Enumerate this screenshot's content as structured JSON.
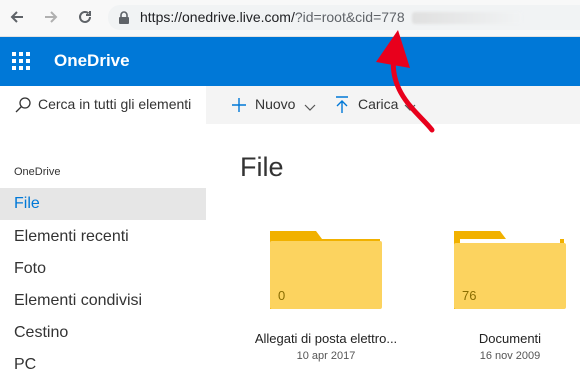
{
  "browser": {
    "url_host": "https://onedrive.live.com/",
    "url_query": "?id=root&cid=778"
  },
  "header": {
    "app_name": "OneDrive",
    "accent": "#0078d7"
  },
  "search": {
    "placeholder": "Cerca in tutti gli elementi"
  },
  "toolbar": {
    "new_label": "Nuovo",
    "upload_label": "Carica"
  },
  "sidebar": {
    "section_label": "OneDrive",
    "items": [
      {
        "label": "File",
        "active": true
      },
      {
        "label": "Elementi recenti"
      },
      {
        "label": "Foto"
      },
      {
        "label": "Elementi condivisi"
      },
      {
        "label": "Cestino"
      },
      {
        "label": "PC"
      }
    ]
  },
  "main": {
    "title": "File",
    "folders": [
      {
        "name": "Allegati di posta elettro...",
        "date": "10 apr 2017",
        "count": "0"
      },
      {
        "name": "Documenti",
        "date": "16 nov 2009",
        "count": "76"
      }
    ]
  },
  "annotation": {
    "arrow_color": "#e8001c"
  }
}
